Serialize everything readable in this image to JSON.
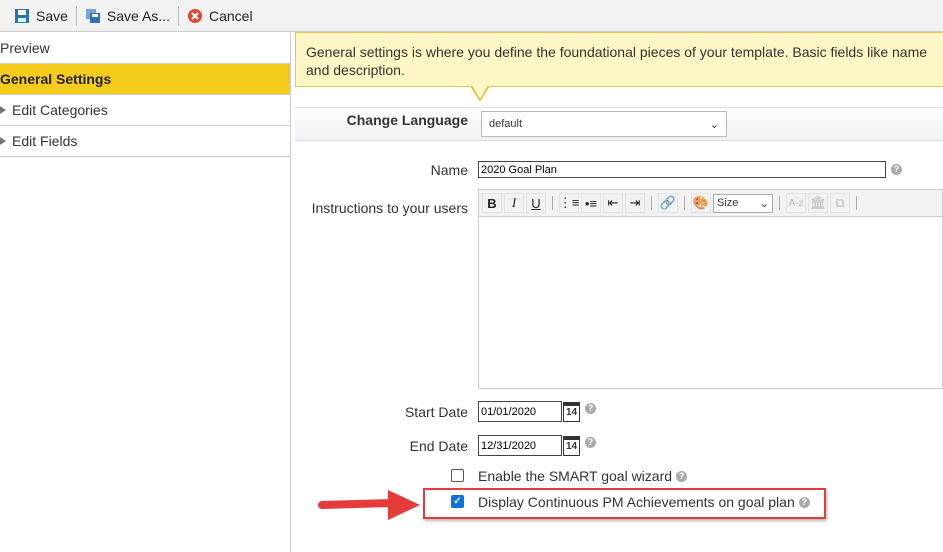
{
  "toolbar": {
    "save": "Save",
    "save_as": "Save As...",
    "cancel": "Cancel"
  },
  "sidebar": {
    "items": [
      {
        "label": "Preview"
      },
      {
        "label": "General Settings"
      },
      {
        "label": "Edit Categories"
      },
      {
        "label": "Edit Fields"
      }
    ]
  },
  "info_tip": "General settings is where you define the foundational pieces of your template. Basic fields like name and description.",
  "language": {
    "label": "Change Language",
    "value": "default"
  },
  "form": {
    "name_label": "Name",
    "name_value": "2020 Goal Plan",
    "instructions_label": "Instructions to your users",
    "size_select": "Size",
    "start_label": "Start Date",
    "start_value": "01/01/2020",
    "end_label": "End Date",
    "end_value": "12/31/2020",
    "calendar_day": "14",
    "smart_label": "Enable the SMART goal wizard",
    "smart_checked": false,
    "cpm_label": "Display Continuous PM Achievements on goal plan",
    "cpm_checked": true
  },
  "colors": {
    "accent": "#f5cc1b",
    "highlight": "#e53b3b",
    "checkbox": "#0b74de"
  }
}
